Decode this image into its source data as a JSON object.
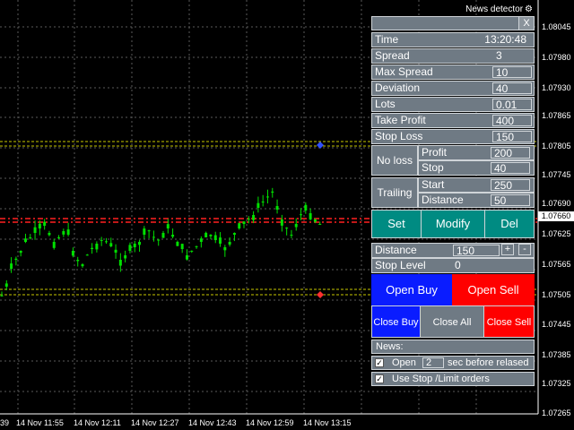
{
  "app": {
    "title": "News detector"
  },
  "chart": {
    "y_labels": [
      "1.08045",
      "1.07980",
      "1.07930",
      "1.07865",
      "1.07805",
      "1.07745",
      "1.07690",
      "1.07625",
      "1.07565",
      "1.07505",
      "1.07445",
      "1.07385",
      "1.07325",
      "1.07265"
    ],
    "current_price": "1.07660",
    "x_labels": [
      "39",
      "14 Nov 11:55",
      "14 Nov 12:11",
      "14 Nov 12:27",
      "14 Nov 12:43",
      "14 Nov 12:59",
      "14 Nov 13:15"
    ],
    "colors": {
      "candles": "#00e000",
      "red_line": "#ff2020",
      "yellow_line": "#c8c800",
      "grid": "#5a5a5a"
    }
  },
  "panel": {
    "close_label": "X",
    "time_label": "Time",
    "time_value": "13:20:48",
    "spread_label": "Spread",
    "spread_value": "3",
    "max_spread_label": "Max Spread",
    "max_spread_value": "10",
    "deviation_label": "Deviation",
    "deviation_value": "40",
    "lots_label": "Lots",
    "lots_value": "0.01",
    "take_profit_label": "Take Profit",
    "take_profit_value": "400",
    "stop_loss_label": "Stop Loss",
    "stop_loss_value": "150",
    "no_loss_label": "No loss",
    "no_loss_profit_label": "Profit",
    "no_loss_profit_value": "200",
    "no_loss_stop_label": "Stop",
    "no_loss_stop_value": "40",
    "trailing_label": "Trailing",
    "trailing_start_label": "Start",
    "trailing_start_value": "250",
    "trailing_distance_label": "Distance",
    "trailing_distance_value": "50",
    "set_label": "Set",
    "modify_label": "Modify",
    "del_label": "Del",
    "distance_label": "Distance",
    "distance_value": "150",
    "plus_label": "+",
    "minus_label": "-",
    "stop_level_label": "Stop Level",
    "stop_level_value": "0",
    "open_buy_label": "Open Buy",
    "open_sell_label": "Open Sell",
    "close_buy_label": "Close Buy",
    "close_all_label": "Close All",
    "close_sell_label": "Close Sell",
    "news_label": "News:",
    "open_label": "Open",
    "open_value": "2",
    "sec_label": "sec before relased",
    "use_stop_label": "Use Stop /Limit orders",
    "check_mark": "✓",
    "colors": {
      "panel_bg": "#6f7a84",
      "teal": "#008b82",
      "blue": "#0a1cff",
      "red": "#ff0000"
    }
  }
}
